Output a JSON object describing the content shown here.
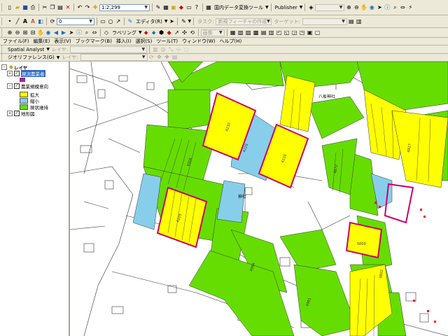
{
  "toolbar1": {
    "scale_value": "1:2,299",
    "tool_label_dataconvert": "国内データ変換ツール",
    "publisher_label": "Publisher",
    "layer_combo_value": ""
  },
  "toolbar2": {
    "snap_value": "0",
    "editor_label": "エディタ(R)",
    "task_label": "タスク:",
    "task_value": "新規フィーチャの作成",
    "target_label": "ターゲット:",
    "target_value": ""
  },
  "toolbar3": {
    "raster_label": "ラベリング",
    "raster_value": "画像"
  },
  "menu": {
    "items": [
      "ファイル(F)",
      "編集(E)",
      "表示(V)",
      "ブックマーク(B)",
      "挿入(I)",
      "選択(S)",
      "ツール(T)",
      "ウィンドウ(W)",
      "ヘルプ(H)"
    ]
  },
  "spatial": {
    "label": "Spatial Analyst",
    "layer_label": "レイヤ:"
  },
  "georef": {
    "label": "ジオリファレンス(G)",
    "layer_label": "レイヤ:"
  },
  "toc": {
    "root_label": "レイヤ",
    "items": [
      {
        "label": "現況農業者"
      },
      {
        "label": "農業規模意向"
      },
      {
        "label": "地形図"
      }
    ],
    "legend": [
      {
        "label": "拡大",
        "color": "#ffff00"
      },
      {
        "label": "縮小",
        "color": "#87ceeb"
      },
      {
        "label": "現状維持",
        "color": "#66dd00"
      }
    ]
  },
  "map": {
    "place_labels": [
      "八坂神社",
      "神社"
    ],
    "parcel_numbers": [
      "4230",
      "4229",
      "4225",
      "4229",
      "5003",
      "4984",
      "4981",
      "4927",
      "6006",
      "4802",
      "4872"
    ]
  },
  "colors": {
    "expand": "#ffff00",
    "shrink": "#87ceeb",
    "maintain": "#66dd00",
    "outline": "#cc0066"
  }
}
